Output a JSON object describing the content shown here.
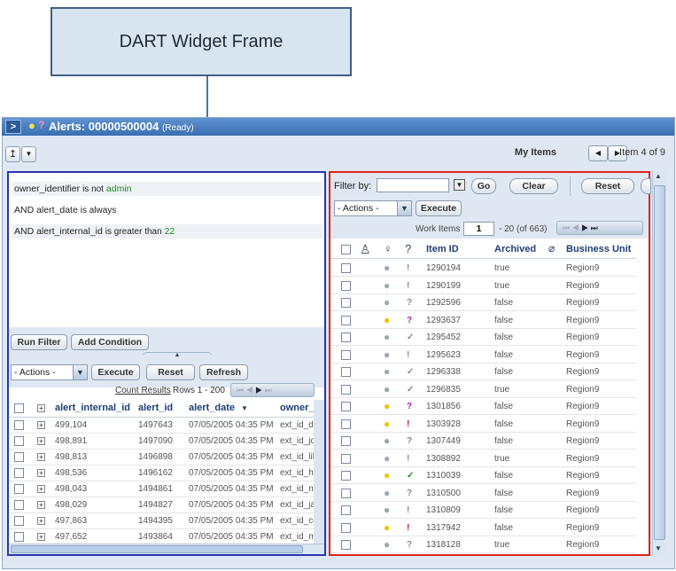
{
  "callout": {
    "label": "DART Widget Frame"
  },
  "window": {
    "title": "Alerts: 00000500004",
    "status": "(Ready)"
  },
  "toolbar": {
    "up_icon": "up-arrow-icon",
    "my_items_label": "My Items",
    "item_position": "Item 4 of 9"
  },
  "filter": {
    "conditions": [
      {
        "field": "owner_identifier",
        "op": "is not",
        "value": "admin",
        "prefix": ""
      },
      {
        "field": "alert_date",
        "op": "is always",
        "value": "",
        "prefix": "AND"
      },
      {
        "field": "alert_internal_id",
        "op": "is greater than",
        "value": "22",
        "prefix": "AND"
      }
    ],
    "run_filter_label": "Run Filter",
    "add_condition_label": "Add Condition"
  },
  "left_actions": {
    "actions_value": "- Actions -",
    "execute_label": "Execute",
    "reset_label": "Reset",
    "refresh_label": "Refresh",
    "count_results_label": "Count Results",
    "rows_label": "Rows 1 - 200"
  },
  "left_grid": {
    "columns": [
      "alert_internal_id",
      "alert_id",
      "alert_date",
      "owner_"
    ],
    "rows": [
      [
        "499,104",
        "1497643",
        "07/05/2005 04:35 PM",
        "ext_id_de"
      ],
      [
        "498,891",
        "1497090",
        "07/05/2005 04:35 PM",
        "ext_id_jo"
      ],
      [
        "498,813",
        "1496898",
        "07/05/2005 04:35 PM",
        "ext_id_lili"
      ],
      [
        "498,536",
        "1496162",
        "07/05/2005 04:35 PM",
        "ext_id_he"
      ],
      [
        "498,043",
        "1494861",
        "07/05/2005 04:35 PM",
        "ext_id_nc"
      ],
      [
        "498,029",
        "1494827",
        "07/05/2005 04:35 PM",
        "ext_id_ja"
      ],
      [
        "497,863",
        "1494395",
        "07/05/2005 04:35 PM",
        "ext_id_cc"
      ],
      [
        "497,652",
        "1493864",
        "07/05/2005 04:35 PM",
        "ext_id_m"
      ]
    ]
  },
  "right_toolbar": {
    "filter_by_label": "Filter by:",
    "filter_value": "",
    "go_label": "Go",
    "clear_label": "Clear",
    "reset_label": "Reset",
    "actions_value": "- Actions -",
    "execute_label": "Execute",
    "work_items_label": "Work Items",
    "page_value": "1",
    "range_label": "- 20 (of 663)"
  },
  "right_grid": {
    "columns": [
      "Item ID",
      "Archived",
      "Business Unit"
    ],
    "rows": [
      {
        "id": "1290194",
        "archived": "true",
        "unit": "Region9",
        "bulb": "off",
        "mark": "!"
      },
      {
        "id": "1290199",
        "archived": "true",
        "unit": "Region9",
        "bulb": "off",
        "mark": "!"
      },
      {
        "id": "1292596",
        "archived": "false",
        "unit": "Region9",
        "bulb": "off",
        "mark": "?"
      },
      {
        "id": "1293637",
        "archived": "false",
        "unit": "Region9",
        "bulb": "on",
        "mark": "?p"
      },
      {
        "id": "1295452",
        "archived": "false",
        "unit": "Region9",
        "bulb": "off",
        "mark": "✓"
      },
      {
        "id": "1295623",
        "archived": "false",
        "unit": "Region9",
        "bulb": "off",
        "mark": "!"
      },
      {
        "id": "1296338",
        "archived": "false",
        "unit": "Region9",
        "bulb": "off",
        "mark": "✓"
      },
      {
        "id": "1296835",
        "archived": "true",
        "unit": "Region9",
        "bulb": "off",
        "mark": "✓"
      },
      {
        "id": "1301856",
        "archived": "false",
        "unit": "Region9",
        "bulb": "on",
        "mark": "?p"
      },
      {
        "id": "1303928",
        "archived": "false",
        "unit": "Region9",
        "bulb": "on",
        "mark": "!r"
      },
      {
        "id": "1307449",
        "archived": "false",
        "unit": "Region9",
        "bulb": "off",
        "mark": "?"
      },
      {
        "id": "1308892",
        "archived": "true",
        "unit": "Region9",
        "bulb": "off",
        "mark": "!"
      },
      {
        "id": "1310039",
        "archived": "false",
        "unit": "Region9",
        "bulb": "on",
        "mark": "✓g"
      },
      {
        "id": "1310500",
        "archived": "false",
        "unit": "Region9",
        "bulb": "off",
        "mark": "?"
      },
      {
        "id": "1310809",
        "archived": "false",
        "unit": "Region9",
        "bulb": "off",
        "mark": "!"
      },
      {
        "id": "1317942",
        "archived": "false",
        "unit": "Region9",
        "bulb": "on",
        "mark": "!r"
      },
      {
        "id": "1318128",
        "archived": "true",
        "unit": "Region9",
        "bulb": "off",
        "mark": "?"
      }
    ]
  },
  "colors": {
    "frame_left": "#2b35b0",
    "frame_right": "#e02020",
    "header_blue": "#1d3f73"
  }
}
